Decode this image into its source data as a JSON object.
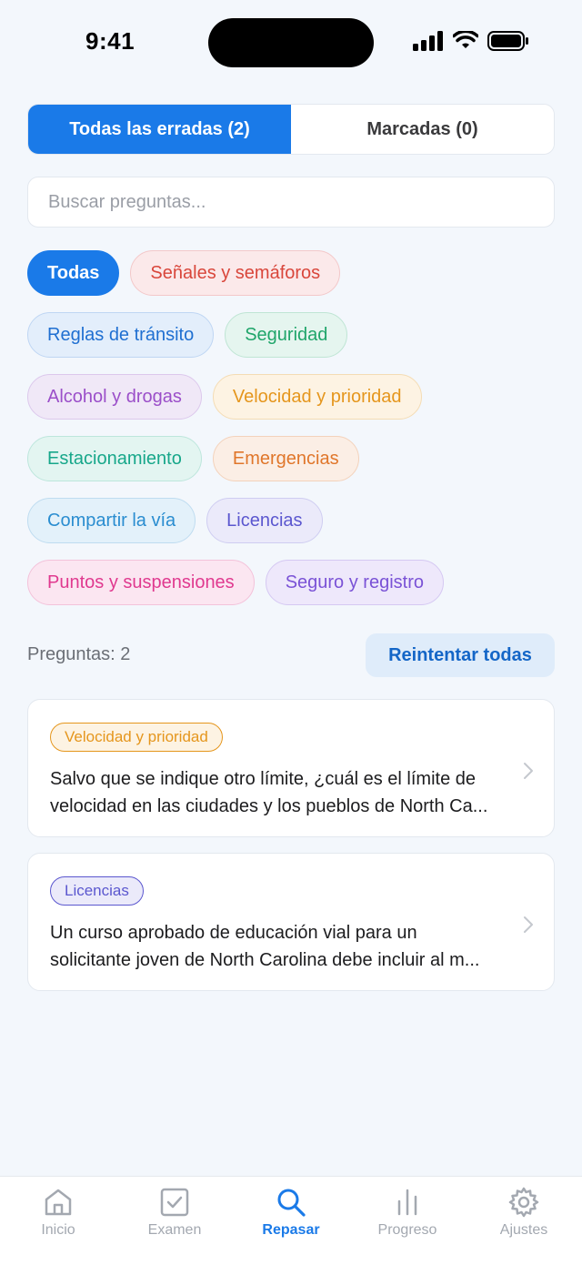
{
  "status_bar": {
    "time": "9:41"
  },
  "segments": [
    {
      "label": "Todas las erradas (2)",
      "active": true
    },
    {
      "label": "Marcadas (0)",
      "active": false
    }
  ],
  "search": {
    "placeholder": "Buscar preguntas...",
    "value": ""
  },
  "chips": {
    "all": "Todas",
    "signals": "Señales y semáforos",
    "rules": "Reglas de tránsito",
    "safety": "Seguridad",
    "alcohol": "Alcohol y drogas",
    "speed": "Velocidad y prioridad",
    "parking": "Estacionamiento",
    "emergencies": "Emergencias",
    "sharing": "Compartir la vía",
    "licenses": "Licencias",
    "points": "Puntos y suspensiones",
    "insurance": "Seguro y registro"
  },
  "count_label": "Preguntas: 2",
  "retry_label": "Reintentar todas",
  "questions": [
    {
      "tag": "Velocidad y prioridad",
      "line1": "Salvo que se indique otro límite, ¿cuál es el límite de",
      "line2": "velocidad en las ciudades y los pueblos de North Ca..."
    },
    {
      "tag": "Licencias",
      "line1": "Un curso aprobado de educación vial para un",
      "line2": "solicitante joven de North Carolina debe incluir al m..."
    }
  ],
  "tabs": [
    {
      "label": "Inicio",
      "icon": "home-icon"
    },
    {
      "label": "Examen",
      "icon": "checkbox-icon"
    },
    {
      "label": "Repasar",
      "icon": "search-icon",
      "active": true
    },
    {
      "label": "Progreso",
      "icon": "bar-chart-icon"
    },
    {
      "label": "Ajustes",
      "icon": "gear-icon"
    }
  ],
  "colors": {
    "accent": "#1a7ae8",
    "background": "#f3f7fc"
  }
}
